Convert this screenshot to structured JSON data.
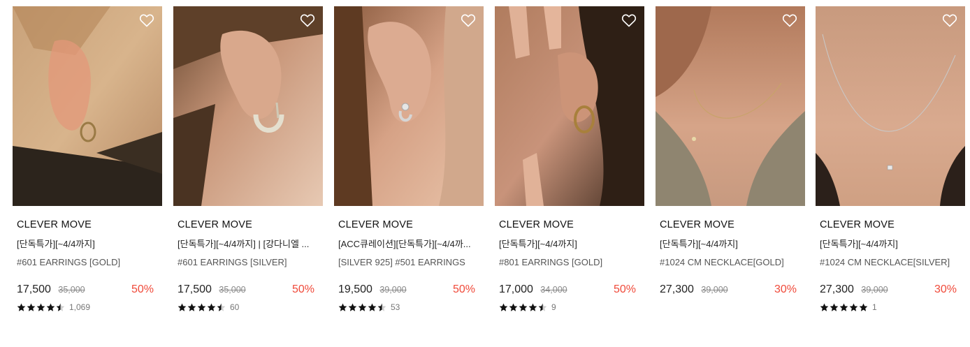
{
  "products": [
    {
      "brand": "CLEVER MOVE",
      "promo": "[단독특가][~4/4까지]",
      "name": "#601 EARRINGS [GOLD]",
      "price": "17,500",
      "original_price": "35,000",
      "discount": "50%",
      "review_count": "1,069",
      "rating": 4.5,
      "image": "ear-gold-hoop-warm",
      "wishlist_icon": "heart-outline-icon"
    },
    {
      "brand": "CLEVER MOVE",
      "promo": "[단독특가][~4/4까지] | [강다니엘 ...",
      "name": "#601 EARRINGS [SILVER]",
      "price": "17,500",
      "original_price": "35,000",
      "discount": "50%",
      "review_count": "60",
      "rating": 4.5,
      "image": "ear-silver-hoop",
      "wishlist_icon": "heart-outline-icon"
    },
    {
      "brand": "CLEVER MOVE",
      "promo": "[ACC큐레이션][단독특가][~4/4까...",
      "name": "[SILVER 925] #501 EARRINGS",
      "price": "19,500",
      "original_price": "39,000",
      "discount": "50%",
      "review_count": "53",
      "rating": 4.5,
      "image": "ear-silver-stud",
      "wishlist_icon": "heart-outline-icon"
    },
    {
      "brand": "CLEVER MOVE",
      "promo": "[단독특가][~4/4까지]",
      "name": "#801 EARRINGS [GOLD]",
      "price": "17,000",
      "original_price": "34,000",
      "discount": "50%",
      "review_count": "9",
      "rating": 4.5,
      "image": "ear-gold-hoop-hand",
      "wishlist_icon": "heart-outline-icon"
    },
    {
      "brand": "CLEVER MOVE",
      "promo": "[단독특가][~4/4까지]",
      "name": "#1024 CM NECKLACE[GOLD]",
      "price": "27,300",
      "original_price": "39,000",
      "discount": "30%",
      "review_count": "",
      "rating": 0,
      "image": "neck-gold-necklace",
      "wishlist_icon": "heart-outline-icon"
    },
    {
      "brand": "CLEVER MOVE",
      "promo": "[단독특가][~4/4까지]",
      "name": "#1024 CM NECKLACE[SILVER]",
      "price": "27,300",
      "original_price": "39,000",
      "discount": "30%",
      "review_count": "1",
      "rating": 5,
      "image": "neck-silver-necklace",
      "wishlist_icon": "heart-outline-icon"
    }
  ],
  "colors": {
    "discount": "#f04a3a",
    "star": "#111111"
  }
}
